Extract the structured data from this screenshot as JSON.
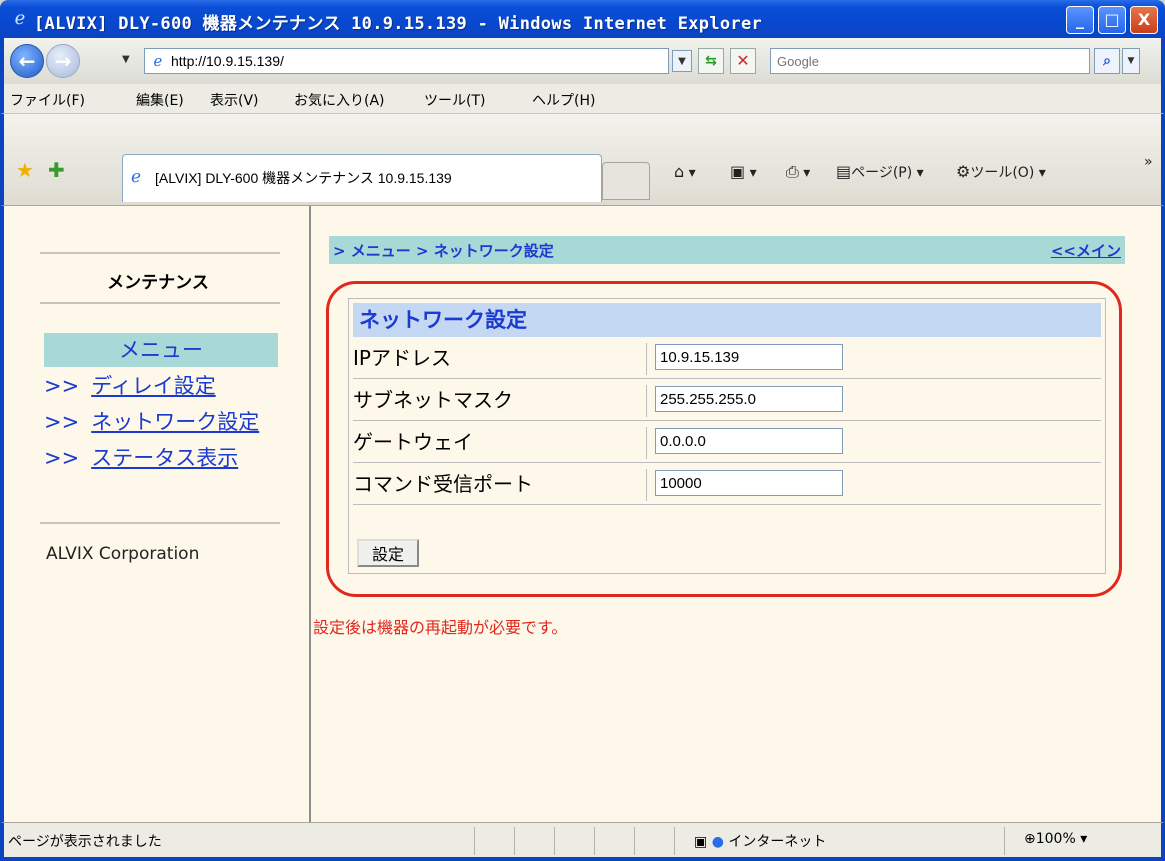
{
  "window": {
    "title": "[ALVIX] DLY-600 機器メンテナンス 10.9.15.139 - Windows Internet Explorer",
    "minimize": "_",
    "maximize": "□",
    "close": "X"
  },
  "address_bar": {
    "url": "http://10.9.15.139/",
    "search_placeholder": "Google"
  },
  "menu": [
    "ファイル(F)",
    "編集(E)",
    "表示(V)",
    "お気に入り(A)",
    "ツール(T)",
    "ヘルプ(H)"
  ],
  "tab": {
    "label": "[ALVIX] DLY-600 機器メンテナンス 10.9.15.139"
  },
  "command_bar": {
    "page": "ページ(P)",
    "tools": "ツール(O)"
  },
  "sidebar": {
    "title": "メンテナンス",
    "menu_heading": "メニュー",
    "arrow": ">>",
    "items": [
      {
        "label": "ディレイ設定"
      },
      {
        "label": "ネットワーク設定"
      },
      {
        "label": "ステータス表示"
      }
    ],
    "company": "ALVIX Corporation"
  },
  "breadcrumb": {
    "path": "> メニュー > ネットワーク設定",
    "main_link": "<<メイン"
  },
  "form": {
    "heading": "ネットワーク設定",
    "fields": [
      {
        "label": "IPアドレス",
        "value": "10.9.15.139"
      },
      {
        "label": "サブネットマスク",
        "value": "255.255.255.0"
      },
      {
        "label": "ゲートウェイ",
        "value": "0.0.0.0"
      },
      {
        "label": "コマンド受信ポート",
        "value": "10000"
      }
    ],
    "submit_label": "設定"
  },
  "note": "設定後は機器の再起動が必要です。",
  "status_bar": {
    "text": "ページが表示されました",
    "zone": "インターネット",
    "zoom": "100%"
  },
  "colors": {
    "accent_teal": "#a9d9d7",
    "link_blue": "#1a3ad0",
    "highlight_red": "#e0281e",
    "form_header": "#c4d8f4"
  }
}
